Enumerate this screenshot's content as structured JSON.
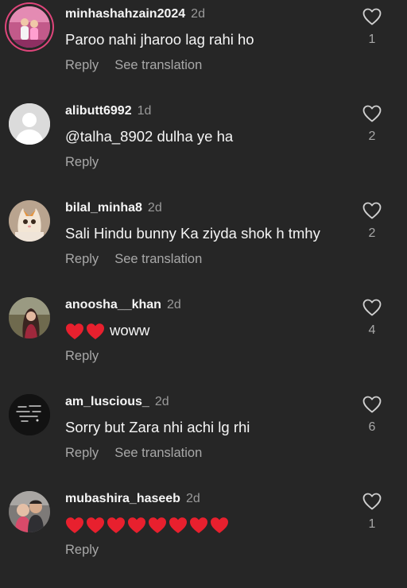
{
  "comments": [
    {
      "username": "minhashahzain2024",
      "time": "2d",
      "text": "Paroo nahi jharoo lag rahi ho",
      "reply_label": "Reply",
      "translate_label": "See translation",
      "likes": "1",
      "avatar_icon": "girls-photo-avatar",
      "has_story_ring": true
    },
    {
      "username": "alibutt6992",
      "time": "1d",
      "text": "@talha_8902 dulha ye ha",
      "reply_label": "Reply",
      "translate_label": "",
      "likes": "2",
      "avatar_icon": "default-person-avatar",
      "has_story_ring": false
    },
    {
      "username": "bilal_minha8",
      "time": "2d",
      "text": "Sali Hindu bunny Ka ziyda shok h tmhy",
      "reply_label": "Reply",
      "translate_label": "See translation",
      "likes": "2",
      "avatar_icon": "kitten-avatar",
      "has_story_ring": false
    },
    {
      "username": "anoosha__khan",
      "time": "2d",
      "text": "woww",
      "heart_emojis": 2,
      "reply_label": "Reply",
      "translate_label": "",
      "likes": "4",
      "avatar_icon": "woman-photo-avatar",
      "has_story_ring": false
    },
    {
      "username": "am_luscious_",
      "time": "2d",
      "text": "Sorry but Zara nhi achi lg rhi",
      "reply_label": "Reply",
      "translate_label": "See translation",
      "likes": "6",
      "avatar_icon": "dark-text-avatar",
      "has_story_ring": false
    },
    {
      "username": "mubashira_haseeb",
      "time": "2d",
      "text": "",
      "heart_emojis": 8,
      "reply_label": "Reply",
      "translate_label": "",
      "likes": "1",
      "avatar_icon": "couple-photo-avatar",
      "has_story_ring": false
    }
  ],
  "colors": {
    "background": "#262626",
    "primary_text": "#f5f5f5",
    "secondary_text": "#a8a8a8",
    "heart_emoji": "#e8202e",
    "story_ring": "#e0457b"
  }
}
